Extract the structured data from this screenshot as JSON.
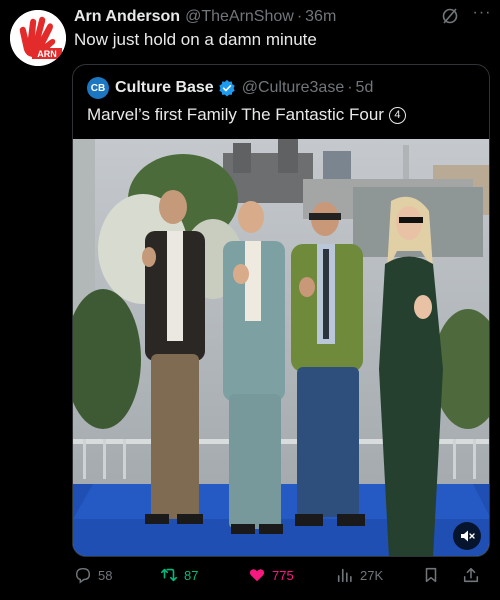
{
  "author": {
    "name": "Arn Anderson",
    "handle": "@TheArnShow",
    "separator": "·",
    "time": "36m",
    "avatar_label": "ARN"
  },
  "post": {
    "text": "Now just hold on a damn minute"
  },
  "quote": {
    "avatar_label": "CB",
    "name": "Culture Base",
    "handle": "@Culture3ase",
    "separator": "·",
    "time": "5d",
    "text": "Marvel’s first Family The Fantastic Four",
    "number_badge": "4"
  },
  "actions": {
    "replies": "58",
    "reposts": "87",
    "likes": "775",
    "views": "27K"
  },
  "colors": {
    "background": "#000000",
    "text": "#e7e9ea",
    "muted": "#71767b",
    "border": "#2f3336",
    "repost_active": "#00ba7c",
    "like_active": "#f91880",
    "verified": "#1d9bf0"
  },
  "icons": [
    "grok-icon",
    "more-icon",
    "verified-icon",
    "mute-icon",
    "reply-icon",
    "repost-icon",
    "like-icon",
    "views-icon",
    "bookmark-icon",
    "share-icon"
  ]
}
